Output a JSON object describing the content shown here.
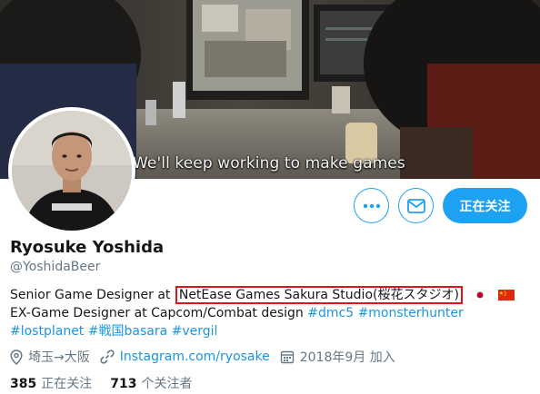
{
  "banner": {
    "subtitle": "We'll keep working to make games"
  },
  "actions": {
    "more_icon": "more-dots-icon",
    "message_icon": "envelope-icon",
    "follow_label": "正在关注"
  },
  "profile": {
    "name": "Ryosuke Yoshida",
    "handle": "@YoshidaBeer",
    "bio": {
      "line1_prefix": "Senior Game Designer at ",
      "line1_highlight": "NetEase Games Sakura Studio(桜花スタジオ)",
      "line2_text": "EX-Game Designer at Capcom/Combat design ",
      "hashtags_line2": [
        "#dmc5",
        "#monsterhunter"
      ],
      "hashtags_line3": [
        "#lostplanet",
        "#戦国basara",
        "#vergil"
      ]
    },
    "location": "埼玉→大阪",
    "website": "Instagram.com/ryosake",
    "joined": "2018年9月 加入",
    "following_count": "385",
    "following_label": "正在关注",
    "followers_count": "713",
    "followers_label": "个关注者"
  },
  "colors": {
    "accent": "#1da1f2",
    "link": "#1b95e0",
    "highlight_box": "#e0141a",
    "secondary_text": "#657786"
  }
}
